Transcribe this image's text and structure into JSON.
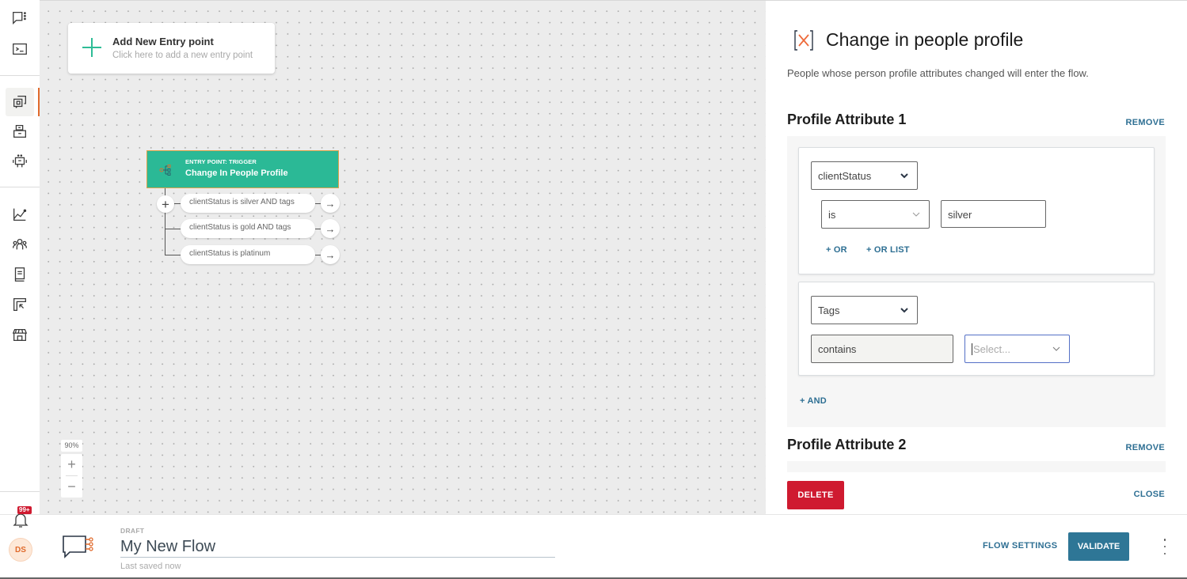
{
  "sidebar": {
    "items": [
      {
        "icon": "chat-flow-icon"
      },
      {
        "icon": "terminal-icon"
      },
      {
        "icon": "flows-icon",
        "active": true
      },
      {
        "icon": "inbox-icon"
      },
      {
        "icon": "bot-icon"
      },
      {
        "icon": "analytics-icon"
      },
      {
        "icon": "people-icon"
      },
      {
        "icon": "knowledge-book-icon"
      },
      {
        "icon": "campaign-icon"
      },
      {
        "icon": "store-icon"
      }
    ],
    "notifications_badge": "99+",
    "avatar_initials": "DS"
  },
  "canvas": {
    "add_entry": {
      "title": "Add New Entry point",
      "subtitle": "Click here to add a new entry point"
    },
    "trigger_node": {
      "label": "ENTRY POINT: TRIGGER",
      "title": "Change In People Profile"
    },
    "conditions": [
      "clientStatus is silver AND tags",
      "clientStatus is gold AND tags",
      "clientStatus is platinum"
    ],
    "zoom_level": "90%",
    "zoom_in": "+",
    "zoom_out": "−"
  },
  "panel": {
    "title": "Change in people profile",
    "description": "People whose person profile attributes changed will enter the flow.",
    "attributes": [
      {
        "heading": "Profile Attribute 1",
        "remove_label": "REMOVE",
        "conditions": [
          {
            "field": "clientStatus",
            "operator": "is",
            "value": "silver",
            "or_label": "+ OR",
            "or_list_label": "+ OR LIST"
          },
          {
            "field": "Tags",
            "operator": "contains",
            "value_placeholder": "Select..."
          }
        ],
        "and_label": "+ AND"
      },
      {
        "heading": "Profile Attribute 2",
        "remove_label": "REMOVE"
      }
    ],
    "delete_label": "DELETE",
    "close_label": "CLOSE"
  },
  "footer": {
    "status": "DRAFT",
    "flow_name": "My New Flow",
    "saved": "Last saved now",
    "flow_settings_label": "FLOW SETTINGS",
    "validate_label": "VALIDATE"
  },
  "colors": {
    "accent_teal": "#2bb996",
    "accent_orange": "#e06a2c",
    "link_blue": "#2e6f93",
    "danger": "#cf1a30",
    "primary_button": "#2e7696"
  }
}
